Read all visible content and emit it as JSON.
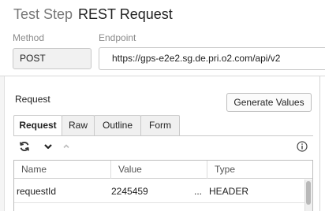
{
  "header": {
    "prefix": "Test Step",
    "title": "REST Request"
  },
  "fields": {
    "method_label": "Method",
    "method_value": "POST",
    "endpoint_label": "Endpoint",
    "endpoint_value": "https://gps-e2e2.sg.de.pri.o2.com/api/v2"
  },
  "request": {
    "label": "Request",
    "generate_button": "Generate Values",
    "tabs": [
      {
        "label": "Request",
        "active": true
      },
      {
        "label": "Raw",
        "active": false
      },
      {
        "label": "Outline",
        "active": false
      },
      {
        "label": "Form",
        "active": false
      }
    ],
    "toolbar": {
      "refresh_icon": "refresh-icon",
      "chevron_icon": "chevron-down-icon",
      "up_icon": "chevron-up-icon",
      "info_icon": "info-icon"
    },
    "table": {
      "columns": [
        "Name",
        "Value",
        "Type"
      ],
      "rows": [
        {
          "name": "requestId",
          "value": "2245459",
          "ellipsis": "...",
          "type": "HEADER"
        }
      ]
    }
  }
}
